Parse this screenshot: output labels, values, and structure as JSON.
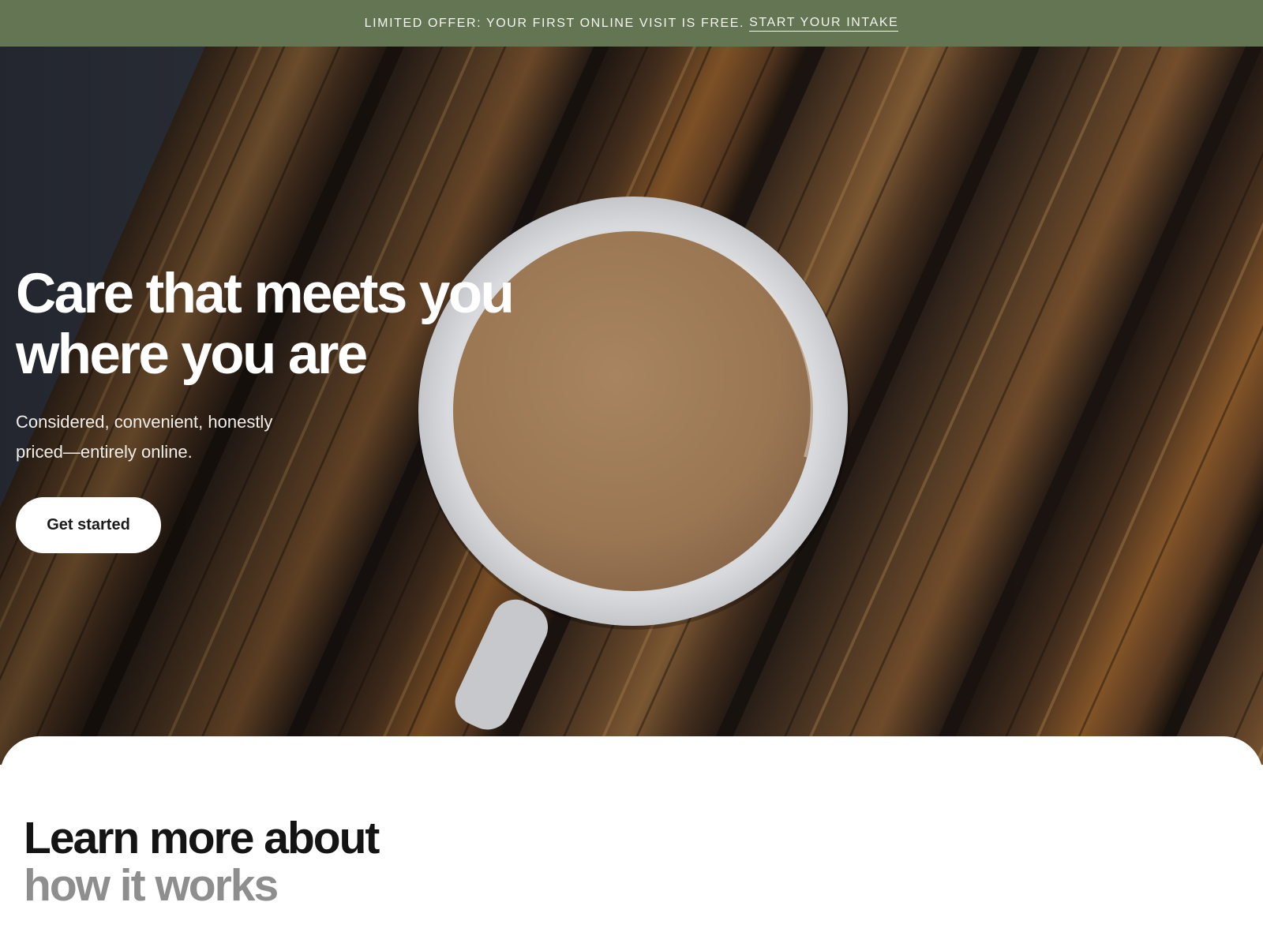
{
  "announcement": {
    "text": "Limited offer: Your first online visit is free.",
    "link_label": "Start your intake",
    "background": "#637553"
  },
  "hero": {
    "image_alt": "Cup of coffee on a dark wooden table",
    "title": "Care that meets you where you are",
    "subtitle": "Considered, convenient, honestly priced—entirely online.",
    "cta_label": "Get started"
  },
  "learn": {
    "heading_line1": "Learn more about",
    "heading_line2": "how it works"
  }
}
